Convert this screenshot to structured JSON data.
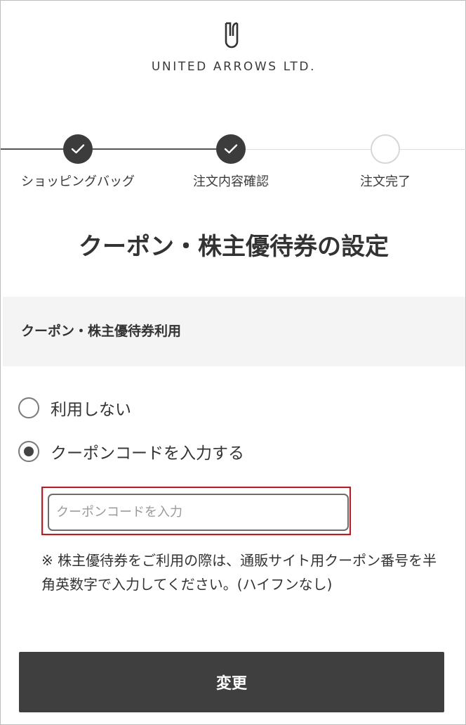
{
  "brand": {
    "logo_text": "UNITED ARROWS LTD."
  },
  "steps": [
    {
      "label": "ショッピングバッグ",
      "status": "done"
    },
    {
      "label": "注文内容確認",
      "status": "done"
    },
    {
      "label": "注文完了",
      "status": "pending"
    }
  ],
  "page_title": "クーポン・株主優待券の設定",
  "section": {
    "title": "クーポン・株主優待券利用"
  },
  "options": [
    {
      "label": "利用しない",
      "selected": false
    },
    {
      "label": "クーポンコードを入力する",
      "selected": true
    }
  ],
  "coupon_input": {
    "value": "",
    "placeholder": "クーポンコードを入力"
  },
  "note": "※ 株主優待券をご利用の際は、通販サイト用クーポン番号を半角英数字で入力してください。(ハイフンなし)",
  "submit_label": "変更",
  "colors": {
    "highlight": "#d0121b",
    "button": "#3f3f3f",
    "section_bg": "#f4f4f4"
  },
  "icons": [
    "logo-mark-icon",
    "check-icon"
  ]
}
